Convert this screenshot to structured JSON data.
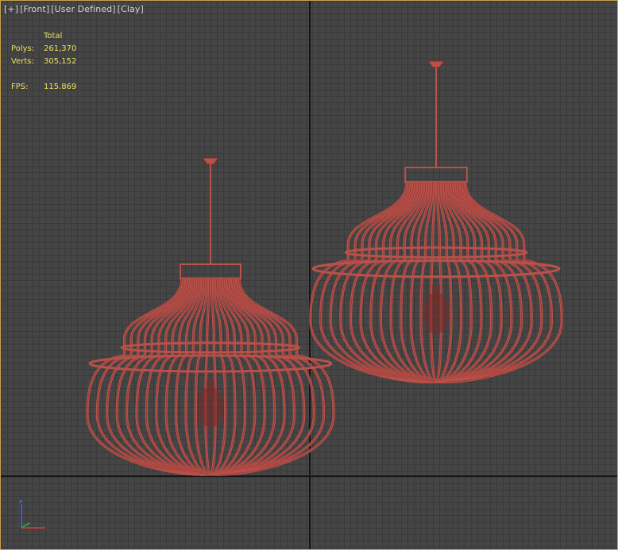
{
  "viewport": {
    "labels": [
      "[+]",
      "[Front]",
      "[User Defined]",
      "[Clay]"
    ],
    "stats": {
      "header": "Total",
      "polys_label": "Polys:",
      "polys_value": "261,370",
      "verts_label": "Verts:",
      "verts_value": "305,152",
      "fps_label": "FPS:",
      "fps_value": "115.869"
    }
  },
  "colors": {
    "lamp": "#b8514a",
    "lamp_dark": "#7a2a26",
    "stats_text": "#e8e060",
    "viewport_border": "#c9a24a",
    "grid_bg": "#454545"
  },
  "gizmo": {
    "icon": "axis-gizmo-icon"
  }
}
